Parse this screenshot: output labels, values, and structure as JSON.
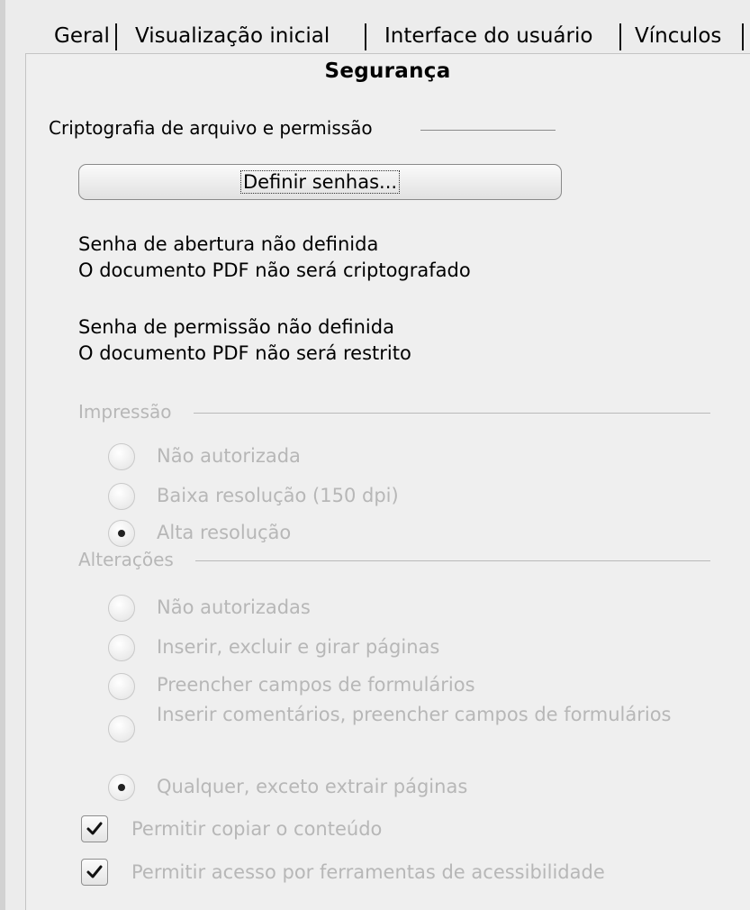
{
  "tabs": [
    {
      "label": "Geral"
    },
    {
      "label": "Visualização inicial"
    },
    {
      "label": "Interface do usuário"
    },
    {
      "label": "Vínculos"
    }
  ],
  "title": "Segurança",
  "encryption": {
    "section_label": "Criptografia de arquivo e permissão",
    "button_label": "Definir senhas...",
    "open_password_status": "Senha de abertura não definida",
    "open_password_effect": "O documento PDF não será criptografado",
    "permission_password_status": "Senha de permissão não definida",
    "permission_password_effect": "O documento PDF não será restrito"
  },
  "printing": {
    "section_label": "Impressão",
    "options": [
      {
        "label": "Não autorizada",
        "selected": false
      },
      {
        "label": "Baixa resolução (150 dpi)",
        "selected": false
      },
      {
        "label": "Alta resolução",
        "selected": true
      }
    ]
  },
  "changes": {
    "section_label": "Alterações",
    "options": [
      {
        "label": "Não autorizadas",
        "selected": false
      },
      {
        "label": "Inserir, excluir e girar páginas",
        "selected": false
      },
      {
        "label": "Preencher campos de formulários",
        "selected": false
      },
      {
        "label": "Inserir comentários, preencher campos de formulários",
        "selected": false
      },
      {
        "label": "Qualquer, exceto extrair páginas",
        "selected": true
      }
    ]
  },
  "content": {
    "copy_label": "Permitir copiar o conteúdo",
    "copy_checked": true,
    "accessibility_label": "Permitir acesso por ferramentas de acessibilidade",
    "accessibility_checked": true
  }
}
